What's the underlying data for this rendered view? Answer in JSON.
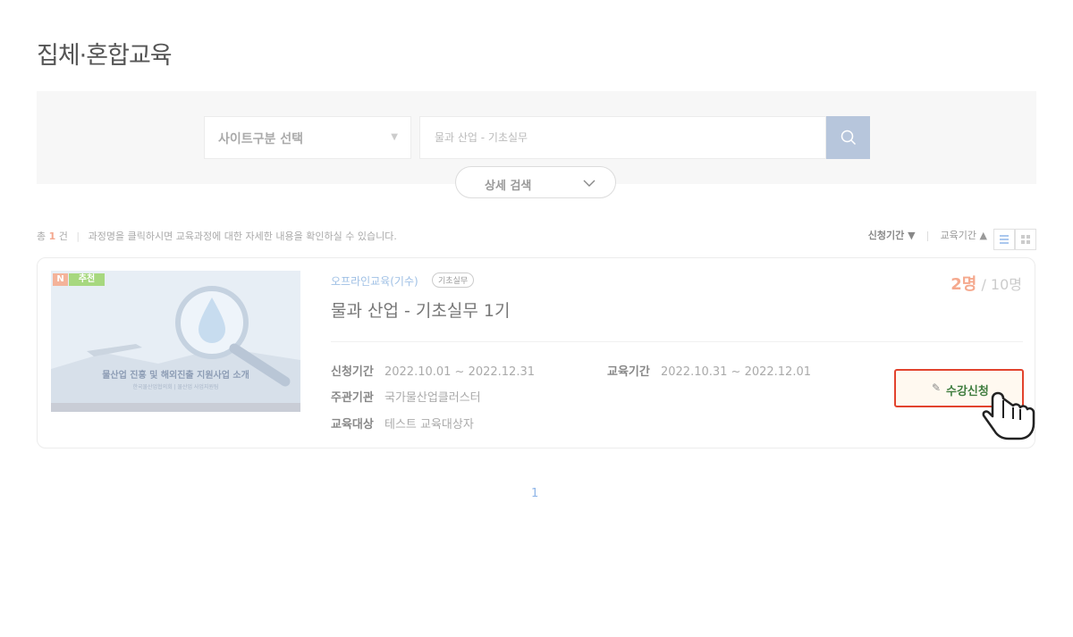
{
  "page": {
    "title": "집체·혼합교육"
  },
  "search": {
    "site_select_label": "사이트구분 선택",
    "query_value": "물과 산업 - 기초실무",
    "detail_label": "상세 검색"
  },
  "summary": {
    "prefix": "총",
    "count": "1",
    "unit": "건",
    "hint": "과정명을 클릭하시면 교육과정에 대한 자세한 내용을 확인하실 수 있습니다."
  },
  "sort": {
    "apply_period": "신청기간 ▼",
    "edu_period": "교육기간 ▲"
  },
  "course": {
    "badges": {
      "new": "N",
      "recommend": "추천"
    },
    "thumbnail_title": "물산업 진흥 및 해외진출 지원사업 소개",
    "thumbnail_sub": "한국물산업협의회 | 물산업 사업지원팀",
    "category": "오프라인교육(기수)",
    "tag": "기초실무",
    "title": "물과 산업 - 기초실무 1기",
    "enrolled": "2명",
    "capacity": "/ 10명",
    "apply_period_label": "신청기간",
    "apply_period_value": "2022.10.01 ~ 2022.12.31",
    "edu_period_label": "교육기간",
    "edu_period_value": "2022.10.31 ~ 2022.12.01",
    "host_label": "주관기관",
    "host_value": "국가물산업클러스터",
    "target_label": "교육대상",
    "target_value": "테스트 교육대상자",
    "apply_button": "수강신청"
  },
  "pagination": {
    "current": "1"
  },
  "colors": {
    "accent_orange": "#f5a98e",
    "accent_blue": "#8fb6e8",
    "highlight_red": "#e2432d"
  }
}
